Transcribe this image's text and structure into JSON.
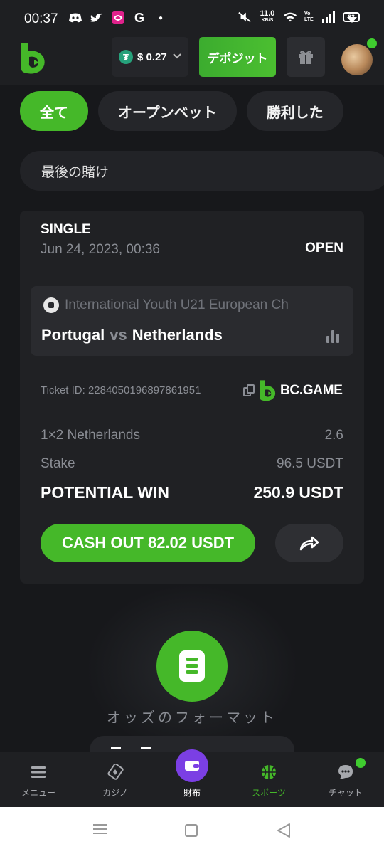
{
  "status_bar": {
    "time": "00:37",
    "speed_value": "11.0",
    "speed_unit": "KB/S",
    "network": "Vo LTE",
    "battery": "83"
  },
  "header": {
    "balance": "$ 0.27",
    "deposit_label": "デポジット"
  },
  "tabs": [
    {
      "label": "全て",
      "active": true
    },
    {
      "label": "オープンベット",
      "active": false
    },
    {
      "label": "勝利した",
      "active": false
    }
  ],
  "filter": {
    "selected": "最後の賭け"
  },
  "bet": {
    "type": "SINGLE",
    "date": "Jun 24, 2023, 00:36",
    "status": "OPEN",
    "league": "International Youth U21 European Ch",
    "home_team": "Portugal",
    "vs": "vs",
    "away_team": "Netherlands",
    "ticket_id": "Ticket ID: 2284050196897861951",
    "brand": "BC.GAME",
    "market": "1×2 Netherlands",
    "odds": "2.6",
    "stake_label": "Stake",
    "stake_value": "96.5 USDT",
    "potential_label": "POTENTIAL WIN",
    "potential_value": "250.9 USDT",
    "cashout_label": "CASH OUT 82.02 USDT"
  },
  "odds_format": {
    "label": "オッズのフォーマット"
  },
  "bottom_nav": [
    {
      "label": "メニュー",
      "icon": "menu-icon"
    },
    {
      "label": "カジノ",
      "icon": "casino-icon"
    },
    {
      "label": "財布",
      "icon": "wallet-icon"
    },
    {
      "label": "スポーツ",
      "icon": "basketball-icon"
    },
    {
      "label": "チャット",
      "icon": "chat-icon"
    }
  ],
  "colors": {
    "accent": "#45b829",
    "background": "#17181b",
    "card": "#202124",
    "wallet": "#7b3fe4",
    "muted": "#8a8d94"
  }
}
